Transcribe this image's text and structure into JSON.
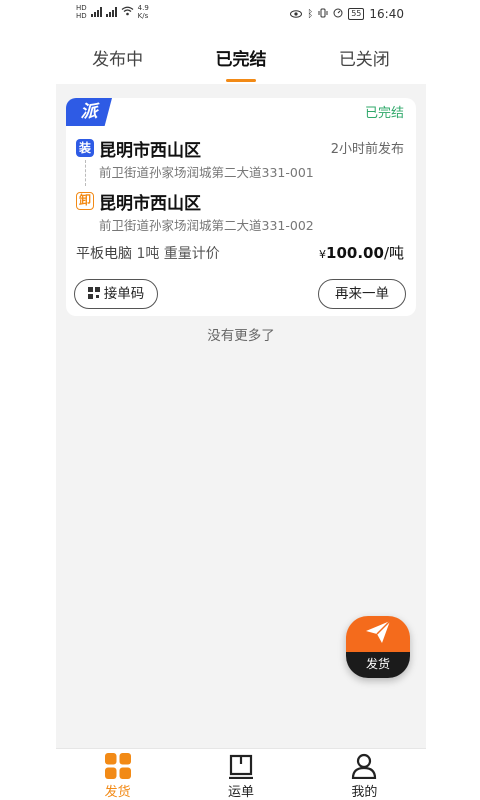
{
  "status_bar": {
    "sim_top": "HD",
    "sim_bottom": "HD",
    "net_speed": "4.9",
    "net_unit": "K/s",
    "battery": "55",
    "time": "16:40"
  },
  "tabs": [
    {
      "label": "发布中",
      "active": false
    },
    {
      "label": "已完结",
      "active": true
    },
    {
      "label": "已关闭",
      "active": false
    }
  ],
  "order": {
    "badge": "派",
    "status": "已完结",
    "load": {
      "tag": "装",
      "city": "昆明市西山区",
      "address": "前卫街道孙家场润城第二大道331-001",
      "time_ago": "2小时前发布"
    },
    "unload": {
      "tag": "卸",
      "city": "昆明市西山区",
      "address": "前卫街道孙家场润城第二大道331-002"
    },
    "goods_name": "平板电脑",
    "goods_detail": "1吨 重量计价",
    "price_symbol": "¥",
    "price_value": "100.00",
    "price_unit": "/吨",
    "btn_qr": "接单码",
    "btn_again": "再来一单"
  },
  "no_more": "没有更多了",
  "fab_label": "发货",
  "bottom_nav": [
    {
      "label": "发货",
      "icon": "grid-icon",
      "active": true
    },
    {
      "label": "运单",
      "icon": "waybill-icon",
      "active": false
    },
    {
      "label": "我的",
      "icon": "user-icon",
      "active": false
    }
  ],
  "colors": {
    "accent": "#f28a16",
    "brand_blue": "#2e5be5",
    "status_green": "#2fa86a",
    "fab_orange": "#f46b1c"
  }
}
